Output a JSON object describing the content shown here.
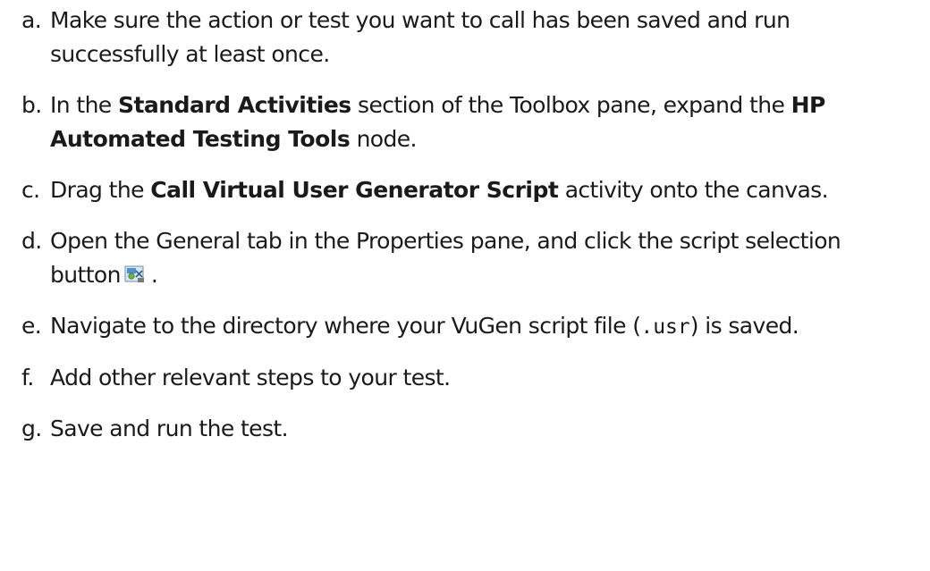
{
  "steps": [
    {
      "marker": "a.",
      "parts": [
        "Make sure the action or test you want to call has been saved and run successfully at least once."
      ]
    },
    {
      "marker": "b.",
      "parts": [
        "In the ",
        "Standard Activities",
        " section of the Toolbox pane, expand the ",
        "HP Automated Testing Tools",
        " node."
      ]
    },
    {
      "marker": "c.",
      "parts": [
        "Drag the ",
        "Call Virtual User Generator Script",
        " activity onto the canvas."
      ]
    },
    {
      "marker": "d.",
      "parts": [
        "Open the General tab in the Properties pane, and click the script selection button",
        "."
      ]
    },
    {
      "marker": "e.",
      "parts": [
        "Navigate to the directory where your VuGen script file (",
        ".usr",
        ") is saved."
      ]
    },
    {
      "marker": "f.",
      "parts": [
        "Add other relevant steps to your test."
      ]
    },
    {
      "marker": "g.",
      "parts": [
        "Save and run the test."
      ]
    }
  ],
  "icons": {
    "script_selection": "script-selection-icon"
  }
}
